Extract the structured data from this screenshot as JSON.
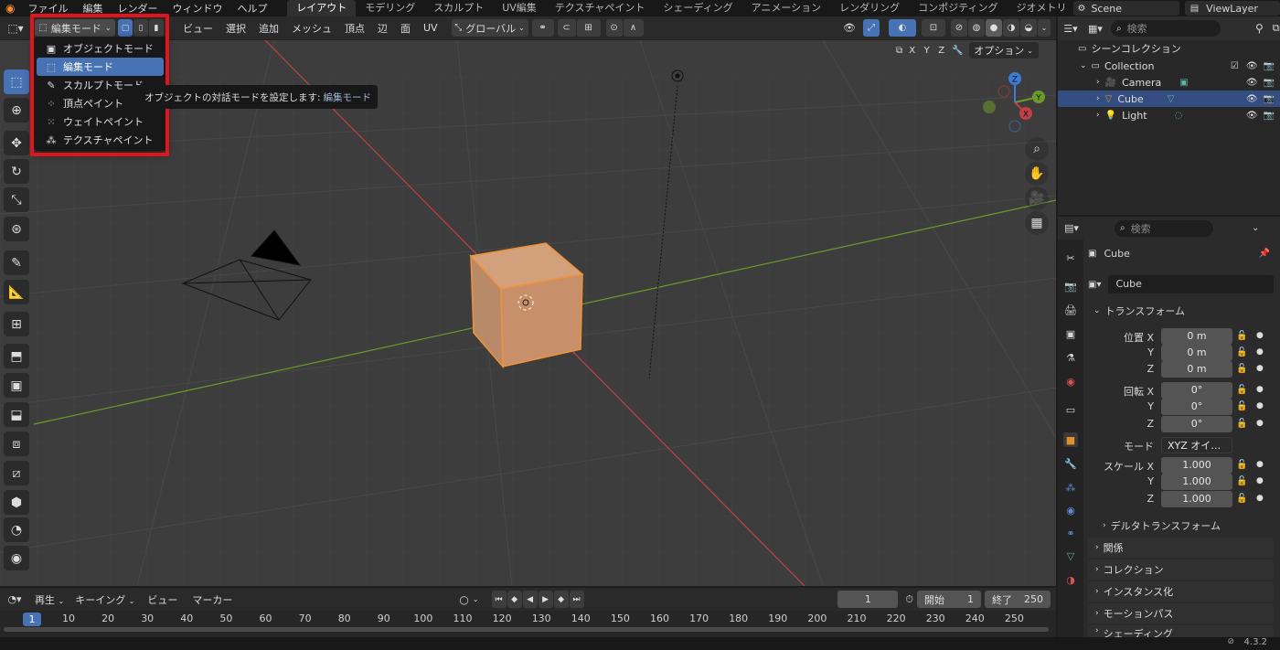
{
  "menubar": {
    "items": [
      "ファイル",
      "編集",
      "レンダー",
      "ウィンドウ",
      "ヘルプ"
    ],
    "workspaces": [
      "レイアウト",
      "モデリング",
      "スカルプト",
      "UV編集",
      "テクスチャペイント",
      "シェーディング",
      "アニメーション",
      "レンダリング",
      "コンポジティング",
      "ジオメトリ"
    ],
    "scene": "Scene",
    "view_layer": "ViewLayer"
  },
  "viewport_header": {
    "mode_label": "編集モード",
    "menus": [
      "ビュー",
      "選択",
      "追加",
      "メッシュ",
      "頂点",
      "辺",
      "面",
      "UV"
    ],
    "transform_orientation": "グローバル",
    "options_label": "オプション",
    "axes": [
      "X",
      "Y",
      "Z"
    ]
  },
  "mode_menu": {
    "items": [
      {
        "label": "オブジェクトモード",
        "icon": "object-mode-icon",
        "selected": false
      },
      {
        "label": "編集モード",
        "icon": "edit-mode-icon",
        "selected": true
      },
      {
        "label": "スカルプトモード",
        "icon": "sculpt-mode-icon",
        "selected": false
      },
      {
        "label": "頂点ペイント",
        "icon": "vertex-paint-icon",
        "selected": false
      },
      {
        "label": "ウェイトペイント",
        "icon": "weight-paint-icon",
        "selected": false
      },
      {
        "label": "テクスチャペイント",
        "icon": "texture-paint-icon",
        "selected": false
      }
    ]
  },
  "tooltip": {
    "text": "オブジェクトの対話モードを設定します:",
    "value": "編集モード"
  },
  "navigation_gizmo": {
    "x": "X",
    "y": "Y",
    "z": "Z"
  },
  "outliner": {
    "search_placeholder": "検索",
    "scene_collection": "シーンコレクション",
    "collection": "Collection",
    "objects": [
      {
        "name": "Camera",
        "selected": false
      },
      {
        "name": "Cube",
        "selected": true
      },
      {
        "name": "Light",
        "selected": false
      }
    ]
  },
  "properties": {
    "search_placeholder": "検索",
    "object_name": "Cube",
    "object_field": "Cube",
    "transform_header": "トランスフォーム",
    "location": {
      "label_x": "位置 X",
      "label_y": "Y",
      "label_z": "Z",
      "x": "0 m",
      "y": "0 m",
      "z": "0 m"
    },
    "rotation": {
      "label_x": "回転 X",
      "label_y": "Y",
      "label_z": "Z",
      "x": "0°",
      "y": "0°",
      "z": "0°"
    },
    "mode_label": "モード",
    "mode_value": "XYZ オイ…",
    "scale": {
      "label_x": "スケール X",
      "label_y": "Y",
      "label_z": "Z",
      "x": "1.000",
      "y": "1.000",
      "z": "1.000"
    },
    "delta_transform": "デルタトランスフォーム",
    "sections": [
      "関係",
      "コレクション",
      "インスタンス化",
      "モーションパス",
      "シェーディング"
    ]
  },
  "timeline": {
    "menus": [
      "再生",
      "キーイング",
      "ビュー",
      "マーカー"
    ],
    "current_frame": "1",
    "start_label": "開始",
    "start": "1",
    "end_label": "終了",
    "end": "250",
    "ticks": [
      "1",
      "10",
      "20",
      "30",
      "40",
      "50",
      "60",
      "70",
      "80",
      "90",
      "100",
      "110",
      "120",
      "130",
      "140",
      "150",
      "160",
      "170",
      "180",
      "190",
      "200",
      "210",
      "220",
      "230",
      "240",
      "250"
    ]
  },
  "status": {
    "version": "4.3.2"
  },
  "colors": {
    "accent": "#4772b3",
    "highlight_box": "#e0141c",
    "cube_fill": "#c8906a",
    "cube_edge": "#f0923a",
    "axis_x": "#c33f48",
    "axis_y": "#6b9b2a",
    "viewport_bg": "#3d3d3d"
  }
}
